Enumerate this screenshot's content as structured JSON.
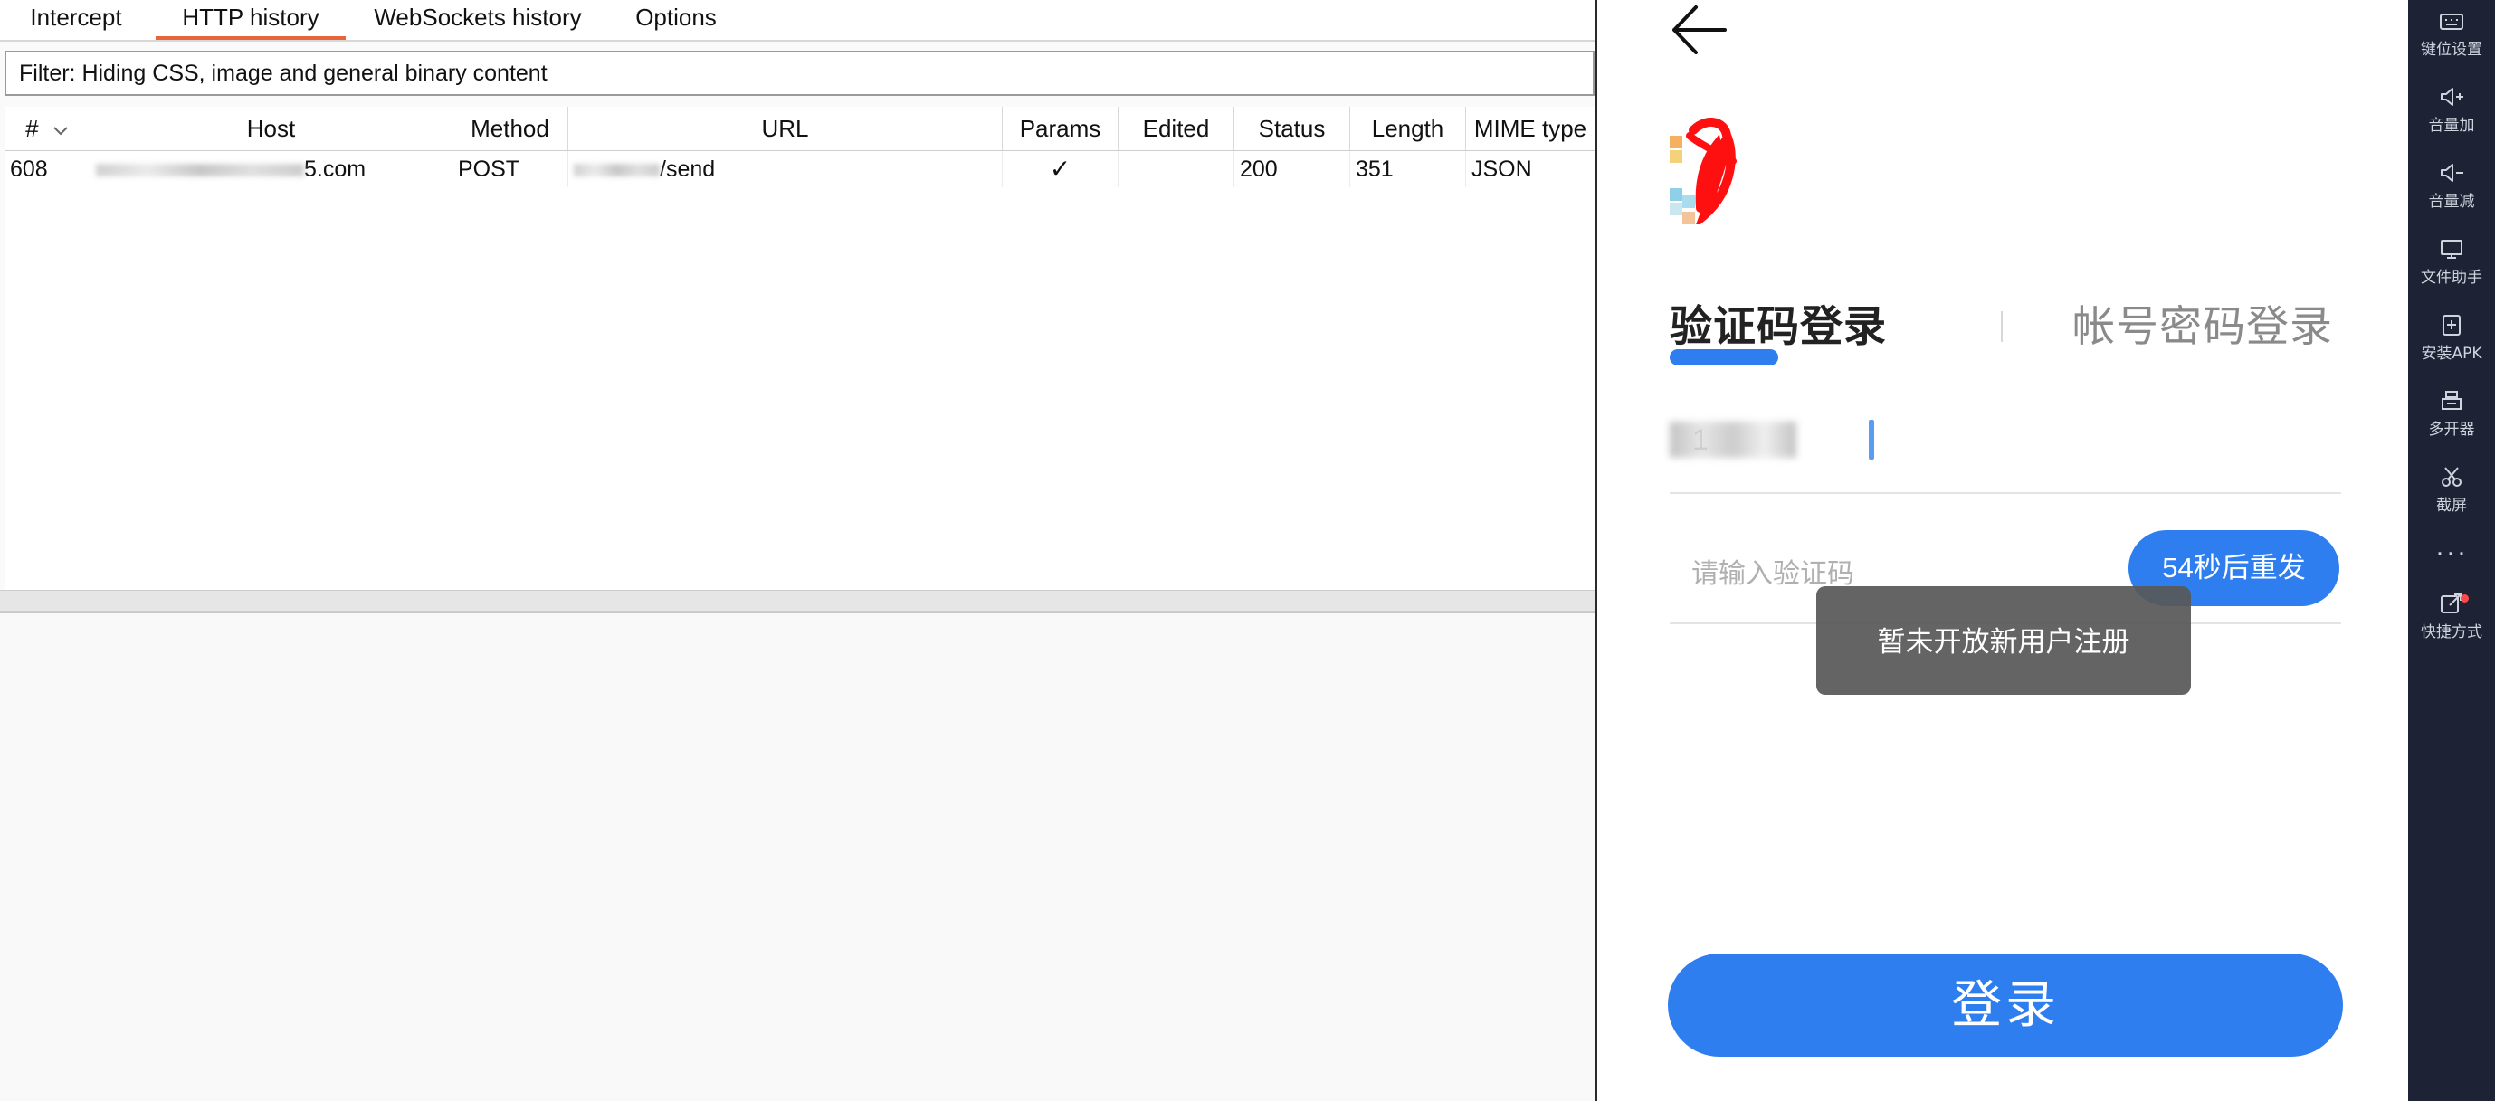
{
  "burp": {
    "tabs": [
      {
        "label": "Intercept",
        "active": false
      },
      {
        "label": "HTTP history",
        "active": true
      },
      {
        "label": "WebSockets history",
        "active": false
      },
      {
        "label": "Options",
        "active": false
      }
    ],
    "accent_color": "#e8643a",
    "filter_text": "Filter: Hiding CSS, image and general binary content",
    "table": {
      "columns": [
        "#",
        "Host",
        "Method",
        "URL",
        "Params",
        "Edited",
        "Status",
        "Length",
        "MIME type"
      ],
      "rows": [
        {
          "num": "608",
          "host_suffix": "5.com",
          "method": "POST",
          "url_suffix": "/send",
          "params": "✓",
          "edited": "",
          "status": "200",
          "length": "351",
          "mime": "JSON"
        }
      ]
    }
  },
  "app": {
    "tab_code_label": "验证码登录",
    "tab_password_label": "帐号密码登录",
    "phone_prefix": "1",
    "code_placeholder": "请输入验证码",
    "resend_label": "54秒后重发",
    "toast_text": "暂未开放新用户注册",
    "login_label": "登录",
    "primary_color": "#2e7ef0"
  },
  "toolbar": {
    "items": [
      {
        "label": "键位设置",
        "icon": "keyboard-icon"
      },
      {
        "label": "音量加",
        "icon": "volume-up-icon"
      },
      {
        "label": "音量减",
        "icon": "volume-down-icon"
      },
      {
        "label": "文件助手",
        "icon": "monitor-icon"
      },
      {
        "label": "安装APK",
        "icon": "install-apk-icon"
      },
      {
        "label": "多开器",
        "icon": "multi-instance-icon"
      },
      {
        "label": "截屏",
        "icon": "scissors-icon"
      },
      {
        "label": "快捷方式",
        "icon": "shortcut-icon"
      }
    ],
    "more_label": "···"
  }
}
